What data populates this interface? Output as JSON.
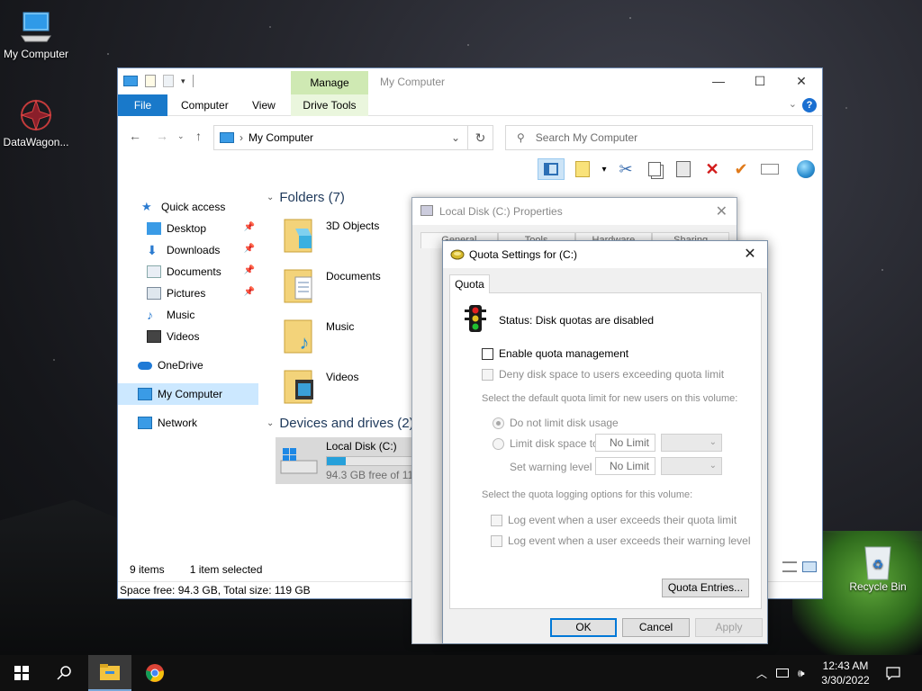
{
  "desktop": {
    "icons": [
      {
        "label": "My Computer",
        "icon": "computer-icon"
      },
      {
        "label": "DataWagon...",
        "icon": "datawagon-icon"
      },
      {
        "label": "Recycle Bin",
        "icon": "recycle-bin-icon"
      }
    ]
  },
  "explorer": {
    "title": "My Computer",
    "manage_tab": "Manage",
    "ribbon_tabs": [
      "File",
      "Computer",
      "View",
      "Drive Tools"
    ],
    "address": "My Computer",
    "search_placeholder": "Search My Computer",
    "nav_items": [
      {
        "label": "Quick access",
        "icon": "star-icon"
      },
      {
        "label": "Desktop",
        "icon": "desktop-icon",
        "pinned": true
      },
      {
        "label": "Downloads",
        "icon": "download-icon",
        "pinned": true
      },
      {
        "label": "Documents",
        "icon": "documents-icon",
        "pinned": true
      },
      {
        "label": "Pictures",
        "icon": "pictures-icon",
        "pinned": true
      },
      {
        "label": "Music",
        "icon": "music-icon"
      },
      {
        "label": "Videos",
        "icon": "videos-icon"
      },
      {
        "label": "OneDrive",
        "icon": "cloud-icon"
      },
      {
        "label": "My Computer",
        "icon": "computer-icon",
        "selected": true
      },
      {
        "label": "Network",
        "icon": "network-icon"
      }
    ],
    "folders_header": "Folders (7)",
    "folders": [
      "3D Objects",
      "Documents",
      "Music",
      "Videos"
    ],
    "devices_header": "Devices and drives (2)",
    "drive": {
      "name": "Local Disk (C:)",
      "free": "94.3 GB free of 119",
      "used_fraction": 0.21
    },
    "status_items": "9 items",
    "status_selected": "1 item selected",
    "space_info": "Space free: 94.3 GB, Total size: 119 GB"
  },
  "properties": {
    "title": "Local Disk (C:) Properties",
    "tabs": [
      "General",
      "Tools",
      "Hardware",
      "Sharing"
    ]
  },
  "quota": {
    "title": "Quota Settings for  (C:)",
    "tab": "Quota",
    "status": "Status:  Disk quotas are disabled",
    "enable_label": "Enable quota management",
    "deny_label": "Deny disk space to users exceeding quota limit",
    "default_limit_label": "Select the default quota limit for new users on this volume:",
    "no_limit_label": "Do not limit disk usage",
    "limit_label": "Limit disk space to",
    "warning_label": "Set warning level to",
    "limit_value": "No Limit",
    "warning_value": "No Limit",
    "logging_label": "Select the quota logging options for this volume:",
    "log_quota_label": "Log event when a user exceeds their quota limit",
    "log_warning_label": "Log event when a user exceeds their warning level",
    "entries_button": "Quota Entries...",
    "ok": "OK",
    "cancel": "Cancel",
    "apply": "Apply"
  },
  "taskbar": {
    "time": "12:43 AM",
    "date": "3/30/2022"
  }
}
